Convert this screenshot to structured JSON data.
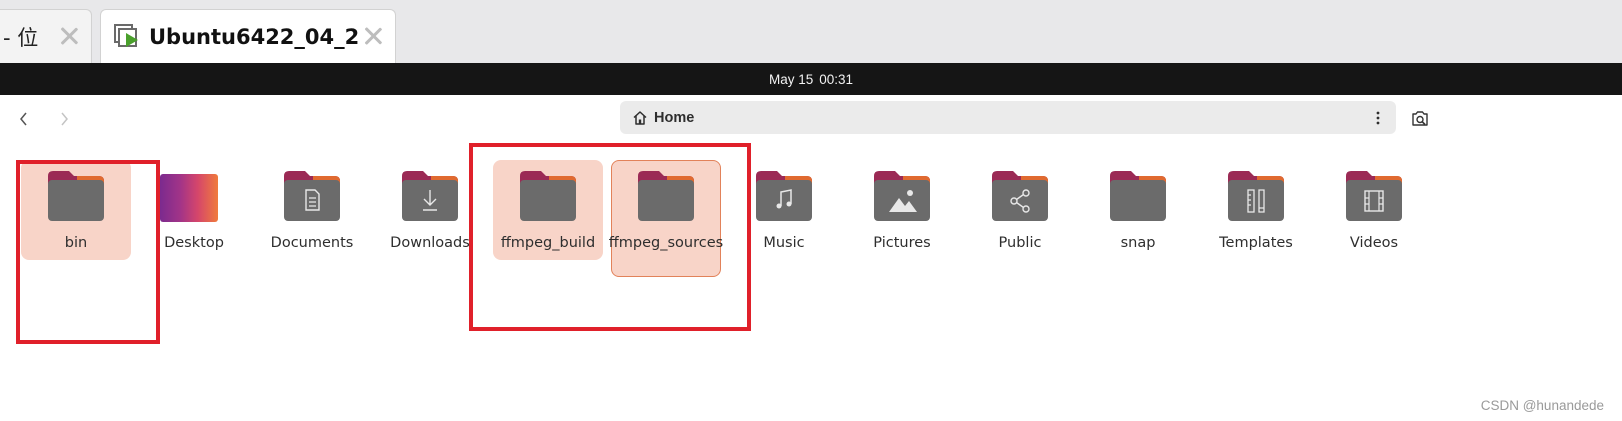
{
  "vm_tabs": [
    {
      "label": "- 位",
      "active": false
    },
    {
      "label": "Ubuntu6422_04_2",
      "active": true
    }
  ],
  "topbar": {
    "date": "May 15",
    "time": "00:31"
  },
  "header": {
    "location": "Home"
  },
  "files": [
    {
      "name": "bin",
      "icon": "folder-icon",
      "selected": true
    },
    {
      "name": "Desktop",
      "icon": "desktop-folder-icon",
      "selected": false
    },
    {
      "name": "Documents",
      "icon": "documents-folder-icon",
      "selected": false
    },
    {
      "name": "Downloads",
      "icon": "downloads-folder-icon",
      "selected": false
    },
    {
      "name": "ffmpeg_build",
      "icon": "folder-icon",
      "selected": true
    },
    {
      "name": "ffmpeg_sources",
      "icon": "folder-icon",
      "selected": true,
      "focused": true
    },
    {
      "name": "Music",
      "icon": "music-folder-icon",
      "selected": false
    },
    {
      "name": "Pictures",
      "icon": "pictures-folder-icon",
      "selected": false
    },
    {
      "name": "Public",
      "icon": "public-folder-icon",
      "selected": false
    },
    {
      "name": "snap",
      "icon": "folder-icon",
      "selected": false
    },
    {
      "name": "Templates",
      "icon": "templates-folder-icon",
      "selected": false
    },
    {
      "name": "Videos",
      "icon": "videos-folder-icon",
      "selected": false
    }
  ],
  "colors": {
    "folder_body": "#6b6b6b",
    "folder_tab": "#9b2a55",
    "folder_accent": "#e95420",
    "selection": "#f8d4c8",
    "annotation": "#e0202a"
  },
  "watermark": "CSDN @hunandede"
}
